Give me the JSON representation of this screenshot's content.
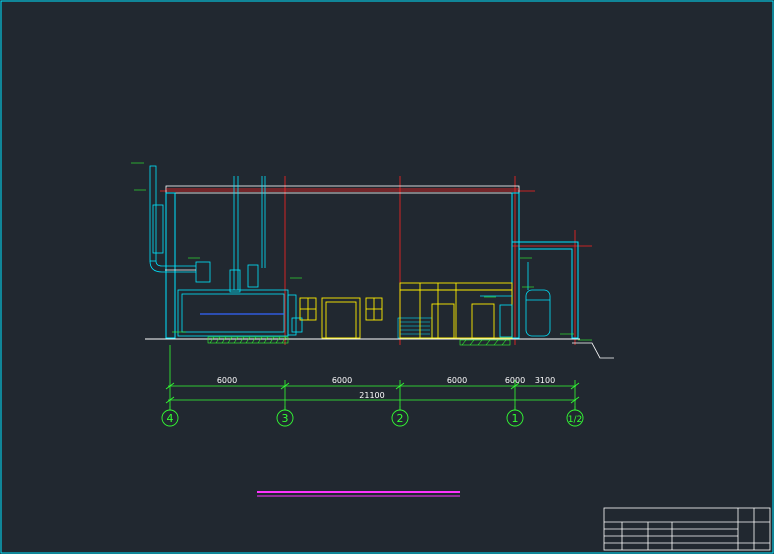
{
  "drawing": {
    "colors": {
      "background": "#212830",
      "wall": "#00e5ff",
      "axis_line": "#ff2222",
      "dimension": "#33ff33",
      "window": "#ffee00",
      "roof": "#ffffff",
      "hatch": "#33ff33",
      "magenta": "#ff33ff"
    },
    "dimensions": {
      "segments": [
        "6000",
        "6000",
        "6000",
        "6000",
        "3100"
      ],
      "total": "21100"
    },
    "axes": [
      "4",
      "3",
      "2",
      "1",
      "1/2"
    ]
  }
}
